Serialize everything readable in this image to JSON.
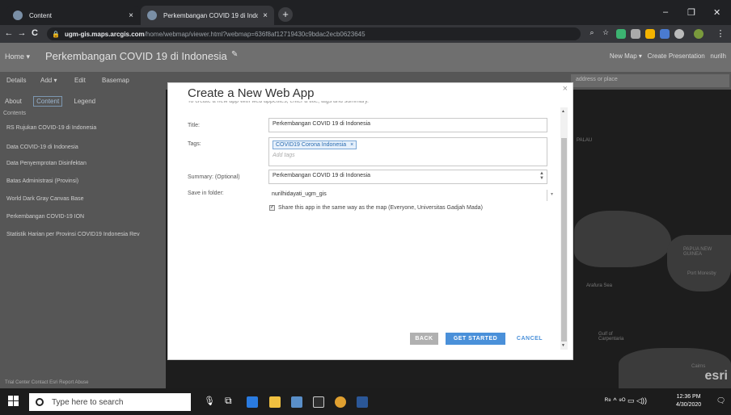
{
  "browser": {
    "tabs": [
      {
        "label": "Content",
        "close": "×"
      },
      {
        "label": "Perkembangan COVID 19 di Indo",
        "close": "×"
      }
    ],
    "new_tab": "+",
    "window_controls": {
      "minimize": "–",
      "maximize": "❐",
      "close": "✕"
    },
    "nav": {
      "back": "←",
      "forward": "→",
      "reload": "C"
    },
    "url_host": "ugm-gis.maps.arcgis.com",
    "url_path": "/home/webmap/viewer.html?webmap=636f8af12719430c9bdac2ecb0623645"
  },
  "app": {
    "home_menu": "Home ▾",
    "page_title": "Perkembangan COVID 19 di Indonesia",
    "new_map": "New Map ▾",
    "create_presentation": "Create Presentation",
    "user": "nurilh",
    "toolbar": {
      "details": "Details",
      "add": "Add ▾",
      "edit": "Edit",
      "basemap": "Basemap",
      "search_placeholder": "address or place"
    },
    "sidebar": {
      "tabs": [
        "About",
        "Content",
        "Legend"
      ],
      "contents_heading": "Contents",
      "layers": [
        "RS Rujukan COVID-19 di Indonesia",
        "Data COVID-19 di Indonesia",
        "Data Penyemprotan Disinfektan",
        "Batas Administrasi (Provinsi)",
        "World Dark Gray Canvas Base",
        "Perkembangan COVID-19 ION",
        "Statistik Harian per Provinsi COVID19 Indonesia Rev"
      ],
      "footer": "Trial Center   Contact Esri   Report Abuse"
    },
    "map_labels": [
      "PALAU",
      "Port Moresby",
      "PAPUA NEW GUINEA",
      "Arafura Sea",
      "Gulf of Carpentaria",
      "Cairns"
    ],
    "esri_logo": "esri"
  },
  "modal": {
    "title": "Create a New Web App",
    "intro_cut": "To create a new app with web appetites, enter a title, tags and summary.",
    "close_icon": "×",
    "fields": {
      "title_label": "Title:",
      "title_value": "Perkembangan COVID 19 di Indonesia",
      "tags_label": "Tags:",
      "tag_chip": "COVID19 Corona Indonesia",
      "tag_remove": "×",
      "tags_placeholder": "Add tags",
      "summary_label": "Summary: (Optional)",
      "summary_value": "Perkembangan COVID 19 di Indonesia",
      "folder_label": "Save in folder:",
      "folder_value": "nurilhidayati_ugm_gis",
      "share_label": "Share this app in the same way as the map (Everyone, Universitas Gadjah Mada)",
      "share_checked": "✓"
    },
    "buttons": {
      "back": "BACK",
      "get_started": "GET STARTED",
      "cancel": "CANCEL"
    }
  },
  "taskbar": {
    "search_placeholder": "Type here to search",
    "time": "12:36 PM",
    "date": "4/30/2020",
    "tray_icons": "ᴿ⁸  ^  ⁹ᴼ  ▭  ◁))"
  },
  "colors": {
    "accent": "#4a90d9",
    "back_btn": "#b0b0b0",
    "chrome_dark": "#202124",
    "page_dim": "#565656"
  }
}
